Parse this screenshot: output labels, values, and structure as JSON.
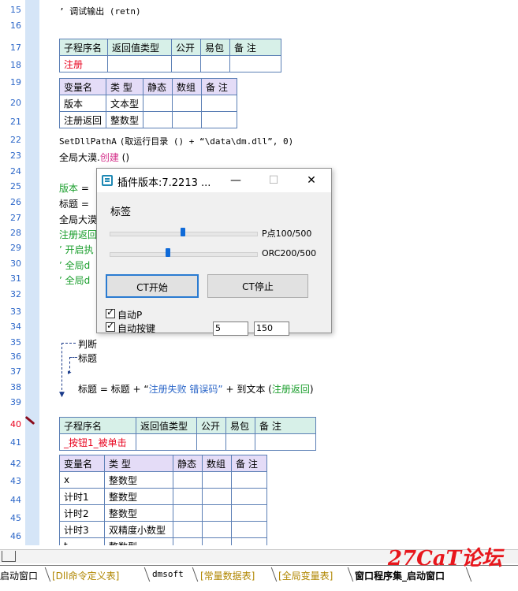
{
  "line_numbers": [
    "15",
    "16",
    "17",
    "18",
    "19",
    "20",
    "21",
    "22",
    "23",
    "24",
    "25",
    "26",
    "27",
    "28",
    "29",
    "30",
    "31",
    "32",
    "33",
    "34",
    "35",
    "36",
    "37",
    "38",
    "39",
    "40",
    "41",
    "42",
    "43",
    "44",
    "45",
    "46"
  ],
  "code": {
    "l15": "’ 调试输出 (retn)",
    "l22a": "SetDllPathA",
    "l22b": "(取运行目录 () + “\\data\\dm.dll”, 0)",
    "l23a": "全局大漠.",
    "l23b": "创建",
    "l23c": " ()",
    "l25a": "版本",
    "l25b": " =",
    "l26": "标题 =",
    "l27": "全局大漠",
    "l28": "注册返回",
    "l29": "’ 开启执",
    "l30": "’ 全局d",
    "l31": "’ 全局d",
    "l35": "判断",
    "l36": "标题",
    "l38a": "标题 = 标题 + “",
    "l38b": "注册失败 错误码”",
    "l38c": " + 到文本 (",
    "l38d": "注册返回",
    "l38e": ")"
  },
  "table1": {
    "headers": [
      "子程序名",
      "返回值类型",
      "公开",
      "易包",
      "备 注"
    ],
    "row": [
      "注册",
      "",
      "",
      "",
      ""
    ]
  },
  "table2": {
    "headers": [
      "变量名",
      "类 型",
      "静态",
      "数组",
      "备 注"
    ],
    "rows": [
      [
        "版本",
        "文本型",
        "",
        "",
        ""
      ],
      [
        "注册返回",
        "整数型",
        "",
        "",
        ""
      ]
    ]
  },
  "table3": {
    "headers": [
      "子程序名",
      "返回值类型",
      "公开",
      "易包",
      "备 注"
    ],
    "row": [
      "_按钮1_被单击",
      "",
      "",
      "",
      ""
    ]
  },
  "table4": {
    "headers": [
      "变量名",
      "类 型",
      "静态",
      "数组",
      "备 注"
    ],
    "rows": [
      [
        "x",
        "整数型",
        "",
        "",
        ""
      ],
      [
        "计时1",
        "整数型",
        "",
        "",
        ""
      ],
      [
        "计时2",
        "整数型",
        "",
        "",
        ""
      ],
      [
        "计时3",
        "双精度小数型",
        "",
        "",
        ""
      ],
      [
        "t",
        "整数型",
        "",
        "",
        ""
      ]
    ]
  },
  "dialog": {
    "title": "插件版本:7.2213 ...",
    "minimize": "—",
    "maximize": "☐",
    "close": "✕",
    "label": "标签",
    "slider1_value": 0.5,
    "slider1_label": "P点100/500",
    "slider2_value": 0.4,
    "slider2_label": "ORC200/500",
    "start_button": "CT开始",
    "stop_button": "CT停止",
    "checkbox1_label": "自动P",
    "checkbox1_checked": true,
    "checkbox2_label": "自动按键",
    "checkbox2_checked": true,
    "input1": "5",
    "input2": "150"
  },
  "tabs": [
    "启动窗口",
    "[Dll命令定义表]",
    "dmsoft",
    "[常量数据表]",
    "[全局变量表]",
    "窗口程序集_启动窗口"
  ],
  "watermark": "27CaT论坛",
  "colors": {
    "accent": "#2b66c8",
    "green": "#1a9e2c",
    "red": "#e8001c",
    "pink": "#d4308a"
  }
}
